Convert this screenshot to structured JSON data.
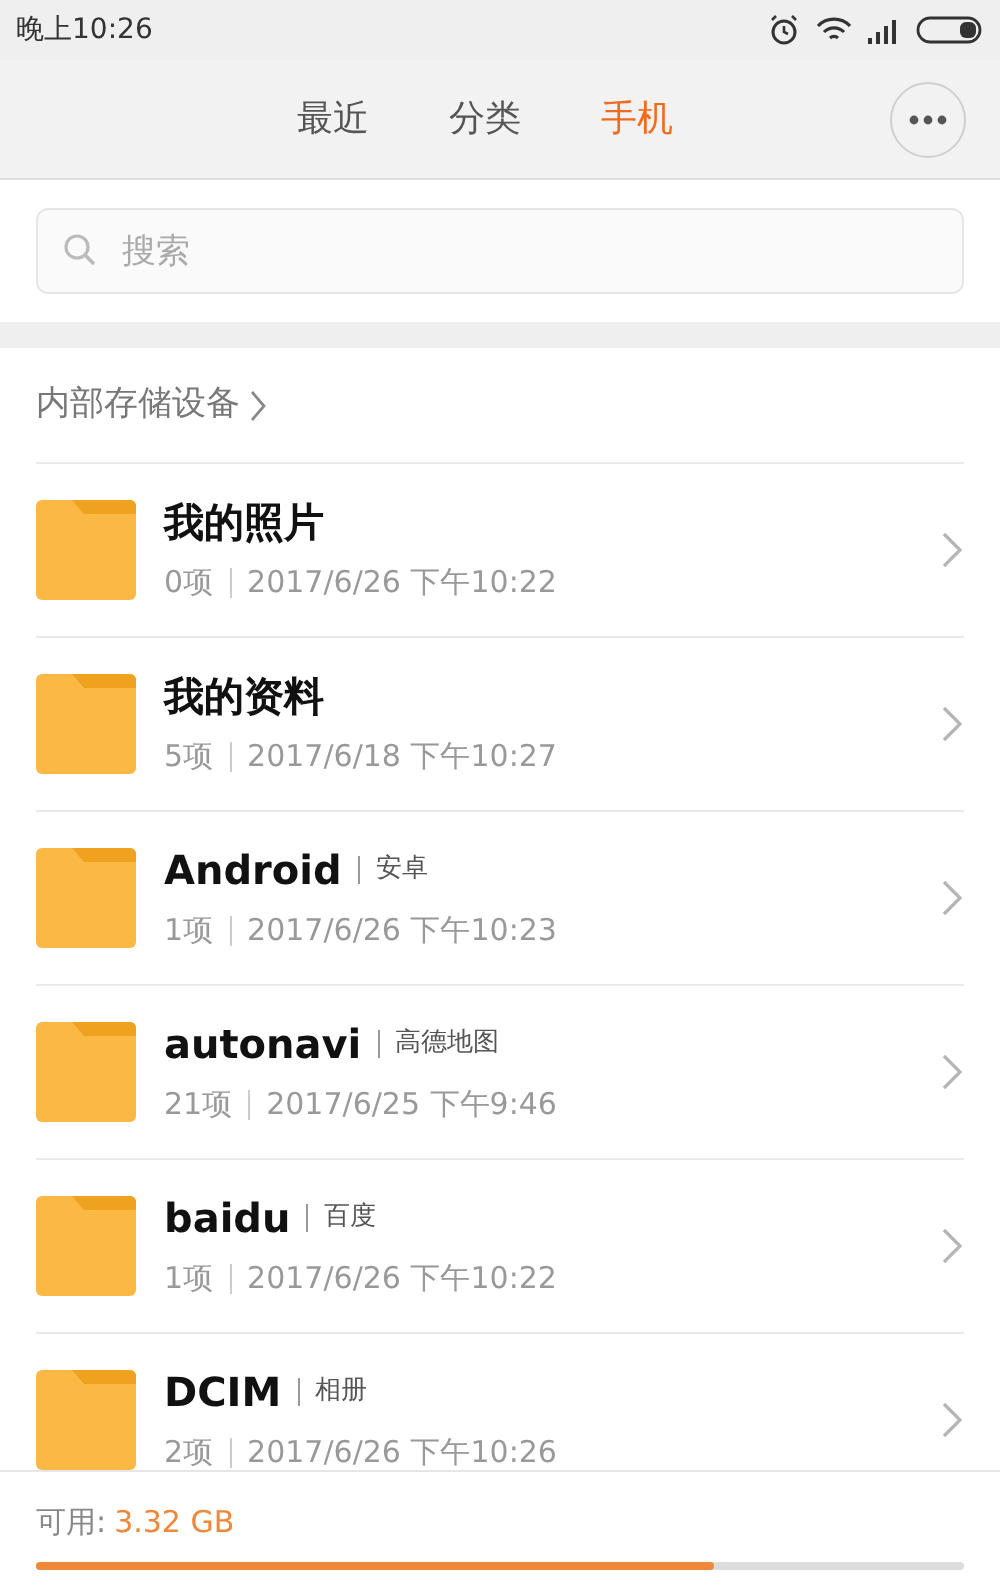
{
  "status_bar": {
    "time": "晚上10:26"
  },
  "tabs": [
    {
      "label": "最近",
      "selected": false
    },
    {
      "label": "分类",
      "selected": false
    },
    {
      "label": "手机",
      "selected": true
    }
  ],
  "search": {
    "placeholder": "搜索"
  },
  "section": {
    "title": "内部存储设备"
  },
  "folders": [
    {
      "name": "我的照片",
      "count": "0项",
      "date": "2017/6/26 下午10:22"
    },
    {
      "name": "我的资料",
      "count": "5项",
      "date": "2017/6/18 下午10:27"
    },
    {
      "name": "Android",
      "tag": "安卓",
      "count": "1项",
      "date": "2017/6/26 下午10:23"
    },
    {
      "name": "autonavi",
      "tag": "高德地图",
      "count": "21项",
      "date": "2017/6/25 下午9:46"
    },
    {
      "name": "baidu",
      "tag": "百度",
      "count": "1项",
      "date": "2017/6/26 下午10:22"
    },
    {
      "name": "DCIM",
      "tag": "相册",
      "count": "2项",
      "date": "2017/6/26 下午10:26"
    }
  ],
  "storage": {
    "label": "可用:",
    "free": "3.32 GB",
    "level": 0.73
  }
}
